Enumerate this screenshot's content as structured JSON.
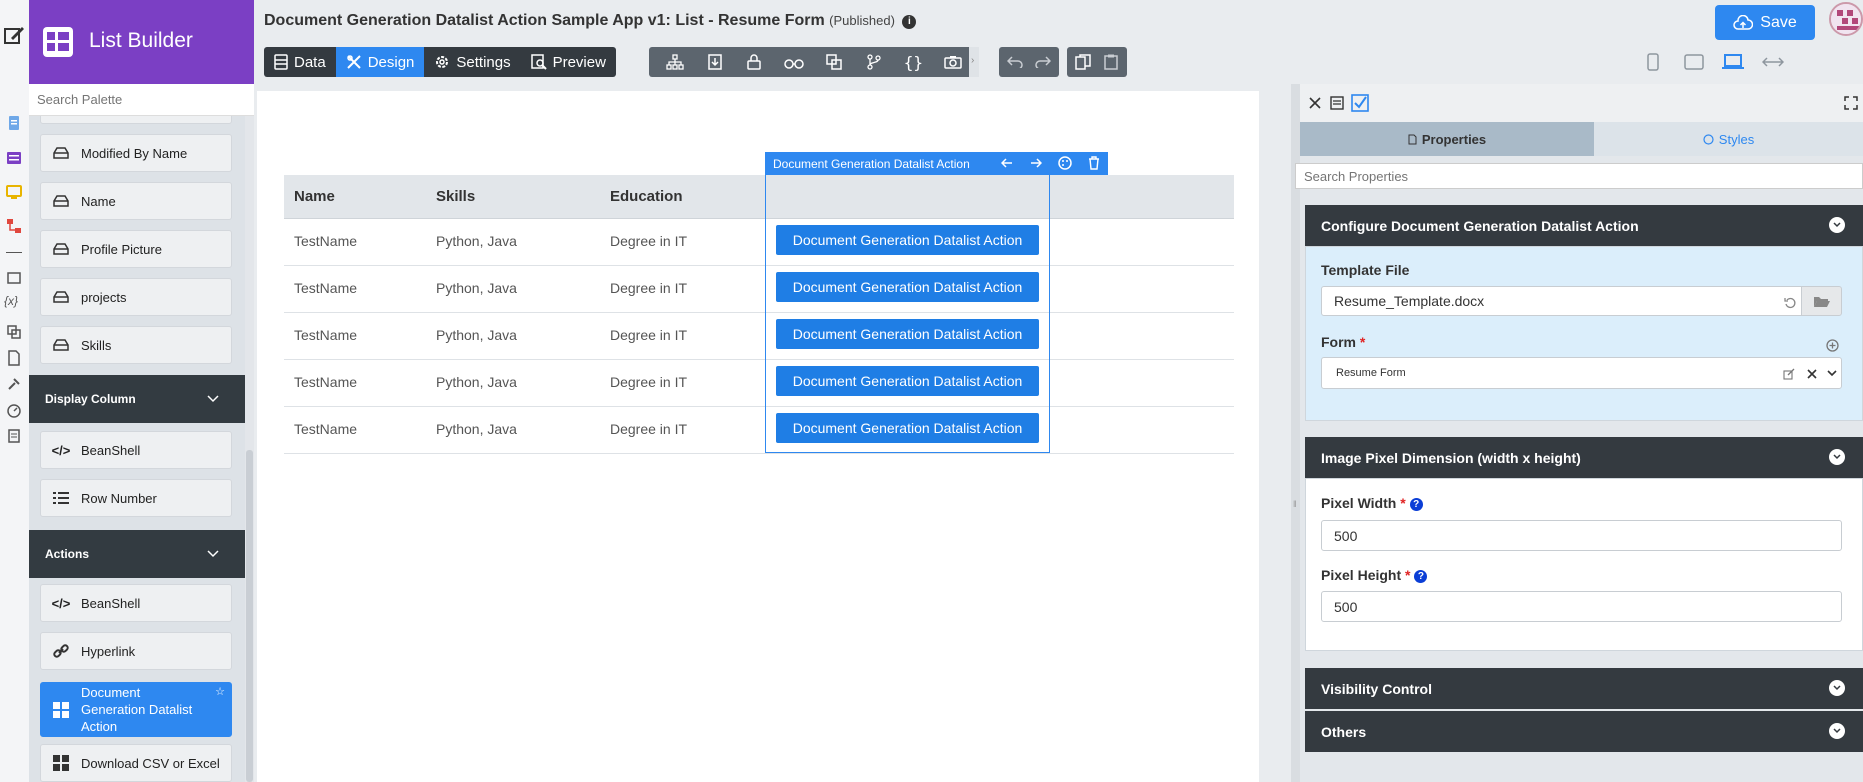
{
  "app": {
    "name": "List Builder"
  },
  "header": {
    "title": "Document Generation Datalist Action Sample App v1: List - Resume Form",
    "status": "(Published)",
    "save_label": "Save"
  },
  "tabs": [
    {
      "label": "Data",
      "icon": "database-icon"
    },
    {
      "label": "Design",
      "icon": "design-icon",
      "selected": true
    },
    {
      "label": "Settings",
      "icon": "gear-icon"
    },
    {
      "label": "Preview",
      "icon": "preview-icon"
    }
  ],
  "palette": {
    "search_placeholder": "Search Palette",
    "items_top": [
      "Modified By Name",
      "Name",
      "Profile Picture",
      "projects",
      "Skills"
    ],
    "section_display": "Display Column",
    "display_items": [
      "BeanShell",
      "Row Number"
    ],
    "section_actions": "Actions",
    "action_items": [
      "BeanShell",
      "Hyperlink",
      "Document Generation Datalist Action",
      "Download CSV or Excel"
    ]
  },
  "table": {
    "headers": [
      "Name",
      "Skills",
      "Education"
    ],
    "rows": [
      {
        "name": "TestName",
        "skills": "Python, Java",
        "education": "Degree in IT"
      },
      {
        "name": "TestName",
        "skills": "Python, Java",
        "education": "Degree in IT"
      },
      {
        "name": "TestName",
        "skills": "Python, Java",
        "education": "Degree in IT"
      },
      {
        "name": "TestName",
        "skills": "Python, Java",
        "education": "Degree in IT"
      },
      {
        "name": "TestName",
        "skills": "Python, Java",
        "education": "Degree in IT"
      }
    ],
    "action_label": "Document Generation Datalist Action",
    "selected_column_label": "Document Generation Datalist Action"
  },
  "properties": {
    "tab_properties": "Properties",
    "tab_styles": "Styles",
    "search_placeholder": "Search Properties",
    "section_configure": "Configure Document Generation Datalist Action",
    "template_file_label": "Template File",
    "template_file_value": "Resume_Template.docx",
    "form_label": "Form",
    "form_value": "Resume Form",
    "section_pixel": "Image Pixel Dimension (width x height)",
    "pixel_width_label": "Pixel Width",
    "pixel_width_value": "500",
    "pixel_height_label": "Pixel Height",
    "pixel_height_value": "500",
    "section_visibility": "Visibility Control",
    "section_others": "Others",
    "required_mark": "*",
    "help_mark": "?"
  },
  "colors": {
    "brand": "#7b3fc4",
    "accent": "#2e88f0",
    "dark": "#343a40"
  }
}
